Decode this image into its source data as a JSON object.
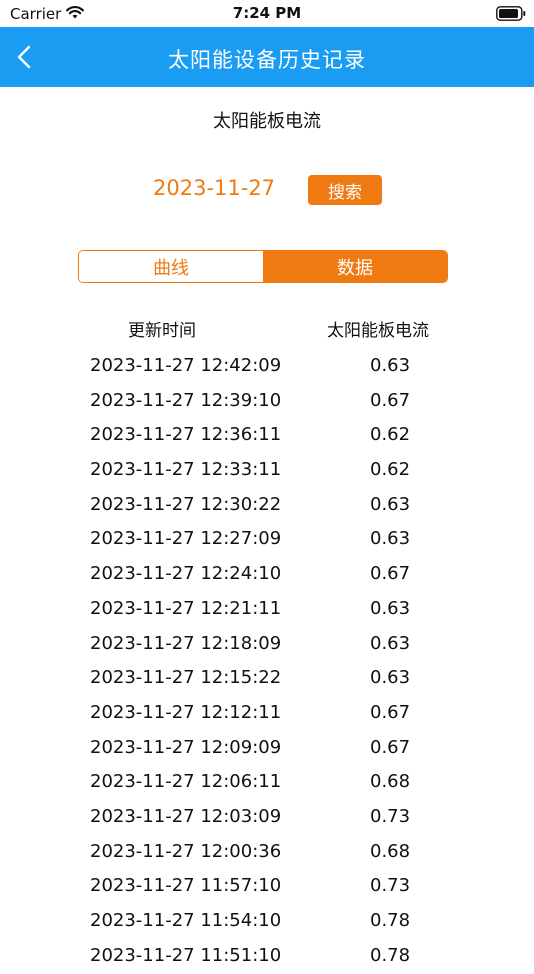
{
  "status_bar": {
    "carrier": "Carrier",
    "time": "7:24 PM"
  },
  "nav": {
    "title": "太阳能设备历史记录"
  },
  "subtitle": "太阳能板电流",
  "filter": {
    "date": "2023-11-27",
    "search_label": "搜索"
  },
  "tabs": {
    "curve_label": "曲线",
    "data_label": "数据",
    "active": "data"
  },
  "table": {
    "headers": {
      "time": "更新时间",
      "current": "太阳能板电流"
    },
    "rows": [
      {
        "time": "2023-11-27 12:42:09",
        "value": "0.63"
      },
      {
        "time": "2023-11-27 12:39:10",
        "value": "0.67"
      },
      {
        "time": "2023-11-27 12:36:11",
        "value": "0.62"
      },
      {
        "time": "2023-11-27 12:33:11",
        "value": "0.62"
      },
      {
        "time": "2023-11-27 12:30:22",
        "value": "0.63"
      },
      {
        "time": "2023-11-27 12:27:09",
        "value": "0.63"
      },
      {
        "time": "2023-11-27 12:24:10",
        "value": "0.67"
      },
      {
        "time": "2023-11-27 12:21:11",
        "value": "0.63"
      },
      {
        "time": "2023-11-27 12:18:09",
        "value": "0.63"
      },
      {
        "time": "2023-11-27 12:15:22",
        "value": "0.63"
      },
      {
        "time": "2023-11-27 12:12:11",
        "value": "0.67"
      },
      {
        "time": "2023-11-27 12:09:09",
        "value": "0.67"
      },
      {
        "time": "2023-11-27 12:06:11",
        "value": "0.68"
      },
      {
        "time": "2023-11-27 12:03:09",
        "value": "0.73"
      },
      {
        "time": "2023-11-27 12:00:36",
        "value": "0.68"
      },
      {
        "time": "2023-11-27 11:57:10",
        "value": "0.73"
      },
      {
        "time": "2023-11-27 11:54:10",
        "value": "0.78"
      },
      {
        "time": "2023-11-27 11:51:10",
        "value": "0.78"
      }
    ]
  },
  "colors": {
    "nav_bg": "#1a9cf3",
    "accent": "#f07a12"
  }
}
